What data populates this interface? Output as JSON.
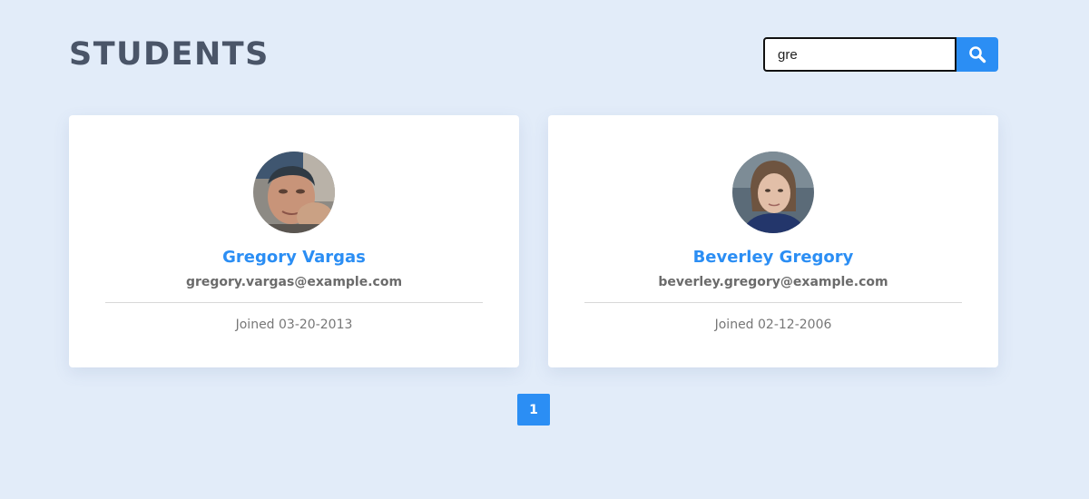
{
  "header": {
    "title": "STUDENTS"
  },
  "search": {
    "value": "gre",
    "button_icon": "search-icon",
    "button_color": "#2b8ef4"
  },
  "students": [
    {
      "name": "Gregory Vargas",
      "email": "gregory.vargas@example.com",
      "joined": "Joined 03-20-2013",
      "avatar": "male-photo-avatar"
    },
    {
      "name": "Beverley Gregory",
      "email": "beverley.gregory@example.com",
      "joined": "Joined 02-12-2006",
      "avatar": "female-photo-avatar"
    }
  ],
  "pagination": {
    "pages": [
      "1"
    ],
    "current": "1"
  },
  "colors": {
    "background": "#e2ecf9",
    "accent": "#2b8ef4",
    "title": "#4a5568"
  }
}
